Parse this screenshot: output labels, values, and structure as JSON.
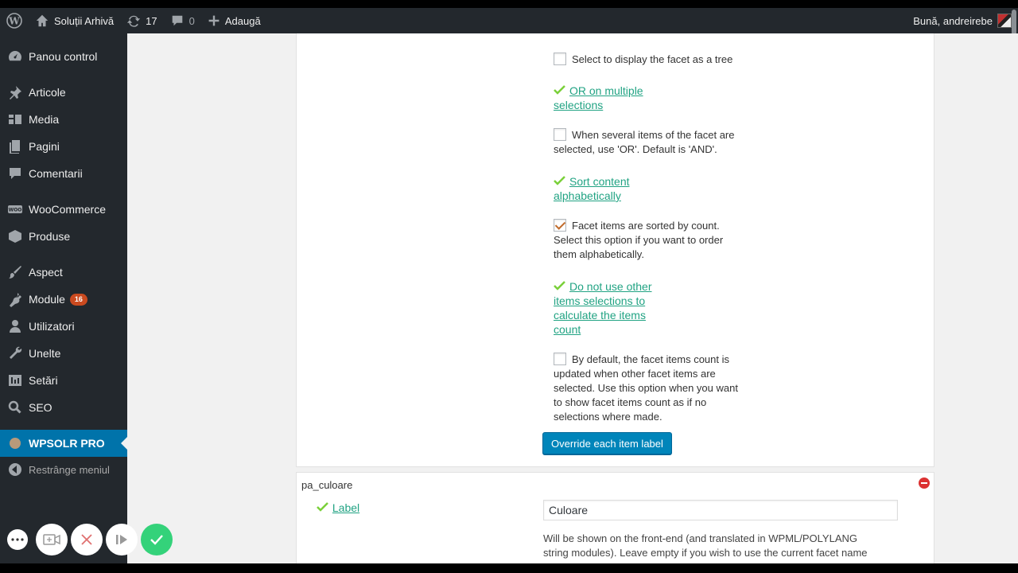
{
  "adminbar": {
    "site_name": "Soluții Arhivă",
    "updates_count": "17",
    "comments_count": "0",
    "add_new": "Adaugă",
    "greeting": "Bună, andreirebe"
  },
  "sidebar": {
    "items": [
      {
        "label": "Panou control",
        "icon": "dashboard-icon"
      },
      {
        "label": "Articole",
        "icon": "pin-icon"
      },
      {
        "label": "Media",
        "icon": "media-icon"
      },
      {
        "label": "Pagini",
        "icon": "pages-icon"
      },
      {
        "label": "Comentarii",
        "icon": "comments-icon"
      },
      {
        "label": "WooCommerce",
        "icon": "woo-icon"
      },
      {
        "label": "Produse",
        "icon": "box-icon"
      },
      {
        "label": "Aspect",
        "icon": "brush-icon"
      },
      {
        "label": "Module",
        "icon": "plugin-icon",
        "badge": "16"
      },
      {
        "label": "Utilizatori",
        "icon": "user-icon"
      },
      {
        "label": "Unelte",
        "icon": "wrench-icon"
      },
      {
        "label": "Setări",
        "icon": "settings-icon"
      },
      {
        "label": "SEO",
        "icon": "search-icon"
      },
      {
        "label": "WPSOLR PRO",
        "icon": "wpsolr-icon"
      },
      {
        "label": "Restrânge meniul",
        "icon": "collapse-icon"
      }
    ]
  },
  "options": [
    {
      "checkbox_text": "Select to display the facet as a tree",
      "checked": false
    },
    {
      "link_line1": "OR on multiple",
      "link_line2": "selections",
      "text1": "When several items of the facet are",
      "text2": "selected, use 'OR'. Default is 'AND'.",
      "checked": false
    },
    {
      "link_line1": "Sort content",
      "link_line2": "alphabetically",
      "text1": "Facet items are sorted by count.",
      "text2": "Select this option if you want to order",
      "text3": "them alphabetically.",
      "checked": true
    },
    {
      "link_line1": "Do not use other",
      "link_line2": "items selections to",
      "link_line3": "calculate the items",
      "link_line4": "count",
      "text1": "By default, the facet items count is",
      "text2": "updated when other facet items are",
      "text3": "selected. Use this option when you want",
      "text4": "to show facet items count as if no",
      "text5": "selections where made.",
      "checked": false
    }
  ],
  "override_button": "Override each item label",
  "facet2": {
    "title": "pa_culoare",
    "label_link": "Label",
    "input_value": "Culoare",
    "help_line1": "Will be shown on the front-end (and translated in WPML/POLYLANG",
    "help_line2": "string modules). Leave empty if you wish to use the current facet name"
  },
  "colors": {
    "admin_bg": "#23282d",
    "active": "#0073aa",
    "link": "#21a383",
    "badge": "#ca4a1f"
  }
}
